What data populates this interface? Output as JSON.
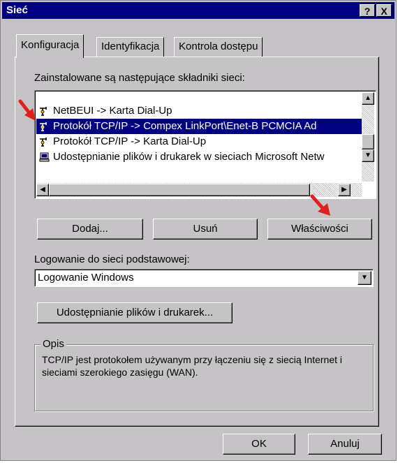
{
  "window": {
    "title": "Sieć",
    "help_btn": "?",
    "close_btn": "X"
  },
  "tabs": [
    {
      "label": "Konfiguracja"
    },
    {
      "label": "Identyfikacja"
    },
    {
      "label": "Kontrola dostępu"
    }
  ],
  "components_label": "Zainstalowane są następujące składniki sieci:",
  "components": [
    {
      "label": "NetBEUI -> Karta Dial-Up",
      "icon": "network-protocol-icon"
    },
    {
      "label": "Protokół TCP/IP -> Compex LinkPort\\Enet-B PCMCIA Ad",
      "icon": "network-protocol-icon",
      "selected": true
    },
    {
      "label": "Protokół TCP/IP -> Karta Dial-Up",
      "icon": "network-protocol-icon"
    },
    {
      "label": "Udostępnianie plików i drukarek w sieciach Microsoft Netw",
      "icon": "file-printer-sharing-icon"
    }
  ],
  "buttons": {
    "add": "Dodaj...",
    "remove": "Usuń",
    "properties": "Właściwości",
    "file_printer_sharing": "Udostępnianie plików i drukarek...",
    "ok": "OK",
    "cancel": "Anuluj"
  },
  "primary_logon_label": "Logowanie do sieci podstawowej:",
  "primary_logon_value": "Logowanie Windows",
  "description": {
    "legend": "Opis",
    "text": "TCP/IP jest protokołem używanym przy łączeniu się z siecią Internet i sieciami szerokiego zasięgu (WAN)."
  },
  "colors": {
    "title_bar": "#000080",
    "face": "#c6c3c6",
    "selection": "#000080",
    "annotation_arrow": "#e0201a"
  }
}
